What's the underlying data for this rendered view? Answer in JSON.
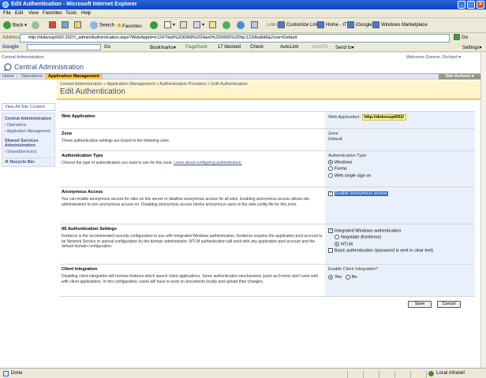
{
  "window": {
    "title": "Edit Authentication - Microsoft Internet Explorer",
    "controls": [
      "_",
      "□",
      "×"
    ]
  },
  "menu": [
    "File",
    "Edit",
    "View",
    "Favorites",
    "Tools",
    "Help"
  ],
  "toolbar": {
    "back": "Back",
    "search": "Search",
    "favorites": "Favorites",
    "links_label": "Links",
    "links": [
      "Customize Links",
      "Home - IT",
      "iGoogle",
      "Windows Marketplace"
    ]
  },
  "address": {
    "label": "Address",
    "url": "http://dubvsspt002:2007/_admin/Authentication.aspx?WebAppId=e12479ad%2D6968%2D4ae0%2D9990%2Dfac1220ba8d6&Zone=Default",
    "go": "Go"
  },
  "googlebar": {
    "label": "Google",
    "go": "Go",
    "bookmarks": "Bookmarks▾",
    "pagerank": "PageRank",
    "blocked": "17 blocked",
    "check": "Check",
    "autolink": "AutoLink",
    "autofill": "AutoFill",
    "sendto": "Send to▾",
    "settings": "Settings▾"
  },
  "sharepoint": {
    "site_link": "Central Administration",
    "welcome": "Welcome Greene, Richard ▾",
    "site_title": "Central Administration",
    "tabs": [
      "Home",
      "Operations",
      "Application Management"
    ],
    "site_actions": "Site Actions ▾",
    "breadcrumb": "Central Administration > Application Management > Authentication Providers > Edit Authentication",
    "page_title": "Edit Authentication"
  },
  "leftnav": {
    "view_all": "View All Site Content",
    "section1_title": "Central Administration",
    "section1_items": [
      "Operations",
      "Application Management"
    ],
    "section2_title": "Shared Services Administration",
    "section2_items": [
      "SharedServices1"
    ],
    "recycle": "Recycle Bin"
  },
  "sections": {
    "webapp": {
      "title": "Web Application",
      "label": "Web Application:",
      "value": "http://dubvsspt002/"
    },
    "zone": {
      "title": "Zone",
      "desc": "These authentication settings are bound to the following zone.",
      "label": "Zone",
      "value": "Default"
    },
    "authtype": {
      "title": "Authentication Type",
      "desc": "Choose the type of authentication you want to use for this zone.",
      "link": "Learn about configuring authentication.",
      "label": "Authentication Type",
      "options": [
        "Windows",
        "Forms",
        "Web single sign on"
      ]
    },
    "anon": {
      "title": "Anonymous Access",
      "desc": "You can enable anonymous access for sites on this server or disallow anonymous access for all sites. Enabling anonymous access allows site administrators to turn anonymous access on. Disabling anonymous access blocks anonymous users in the web.config file for this zone.",
      "checkbox": "Enable anonymous access"
    },
    "iis": {
      "title": "IIS Authentication Settings",
      "desc": "Kerberos is the recommended security configuration to use with Integrated Windows authentication. Kerberos requires the application pool account to be Network Service or special configuration by the domain administrator. NTLM authentication will work with any application pool account and the default domain configuration.",
      "integrated": "Integrated Windows authentication",
      "negotiate": "Negotiate (Kerberos)",
      "ntlm": "NTLM",
      "basic": "Basic authentication (password is sent in clear text)"
    },
    "client": {
      "title": "Client Integration",
      "desc": "Disabling client integration will remove features which launch client applications. Some authentication mechanisms (such as Forms) don't work well with client applications. In this configuration, users will have to work on documents locally and upload their changes.",
      "label": "Enable Client Integration?",
      "yes": "Yes",
      "no": "No"
    }
  },
  "buttons": {
    "save": "Save",
    "cancel": "Cancel"
  },
  "status": {
    "left": "Done",
    "zone": "Local intranet"
  }
}
